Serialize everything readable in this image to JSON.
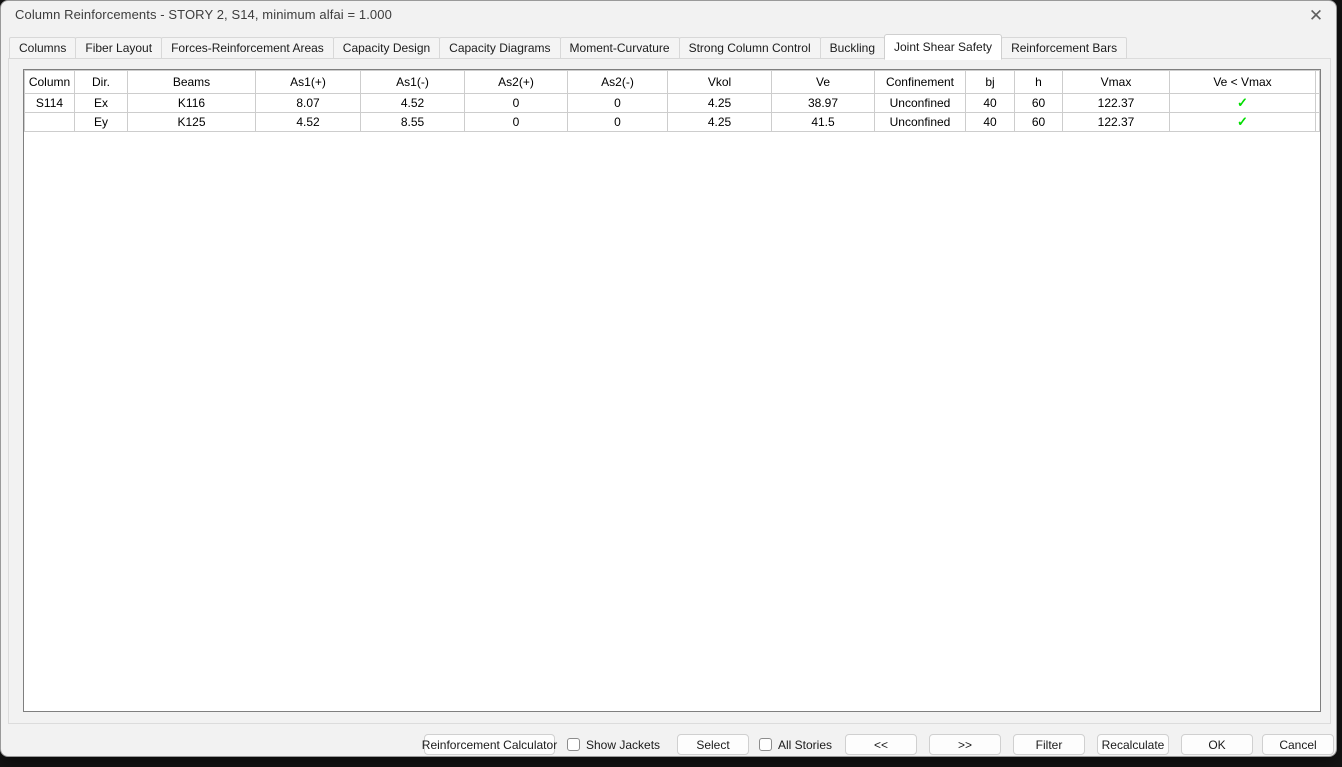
{
  "window": {
    "title": "Column Reinforcements - STORY 2, S14, minimum alfai = 1.000",
    "close_icon": "✕"
  },
  "tabs": [
    {
      "label": "Columns",
      "active": false
    },
    {
      "label": "Fiber Layout",
      "active": false
    },
    {
      "label": "Forces-Reinforcement Areas",
      "active": false
    },
    {
      "label": "Capacity Design",
      "active": false
    },
    {
      "label": "Capacity Diagrams",
      "active": false
    },
    {
      "label": "Moment-Curvature",
      "active": false
    },
    {
      "label": "Strong Column Control",
      "active": false
    },
    {
      "label": "Buckling",
      "active": false
    },
    {
      "label": "Joint Shear Safety",
      "active": true
    },
    {
      "label": "Reinforcement Bars",
      "active": false
    }
  ],
  "table": {
    "columns": [
      "Column",
      "Dir.",
      "Beams",
      "As1(+)",
      "As1(-)",
      "As2(+)",
      "As2(-)",
      "Vkol",
      "Ve",
      "Confinement",
      "bj",
      "h",
      "Vmax",
      "Ve < Vmax"
    ],
    "rows": [
      [
        "S114",
        "Ex",
        "K116",
        "8.07",
        "4.52",
        "0",
        "0",
        "4.25",
        "38.97",
        "Unconfined",
        "40",
        "60",
        "122.37",
        "✓"
      ],
      [
        "",
        "Ey",
        "K125",
        "4.52",
        "8.55",
        "0",
        "0",
        "4.25",
        "41.5",
        "Unconfined",
        "40",
        "60",
        "122.37",
        "✓"
      ]
    ]
  },
  "footer": {
    "reinforcement_calculator": "Reinforcement Calculator",
    "show_jackets": {
      "label": "Show Jackets",
      "checked": false
    },
    "select": "Select",
    "all_stories": {
      "label": "All Stories",
      "checked": false
    },
    "prev": "<<",
    "next": ">>",
    "filter": "Filter",
    "recalculate": "Recalculate",
    "ok": "OK",
    "cancel": "Cancel"
  },
  "colors": {
    "check_green": "#00dd00"
  }
}
